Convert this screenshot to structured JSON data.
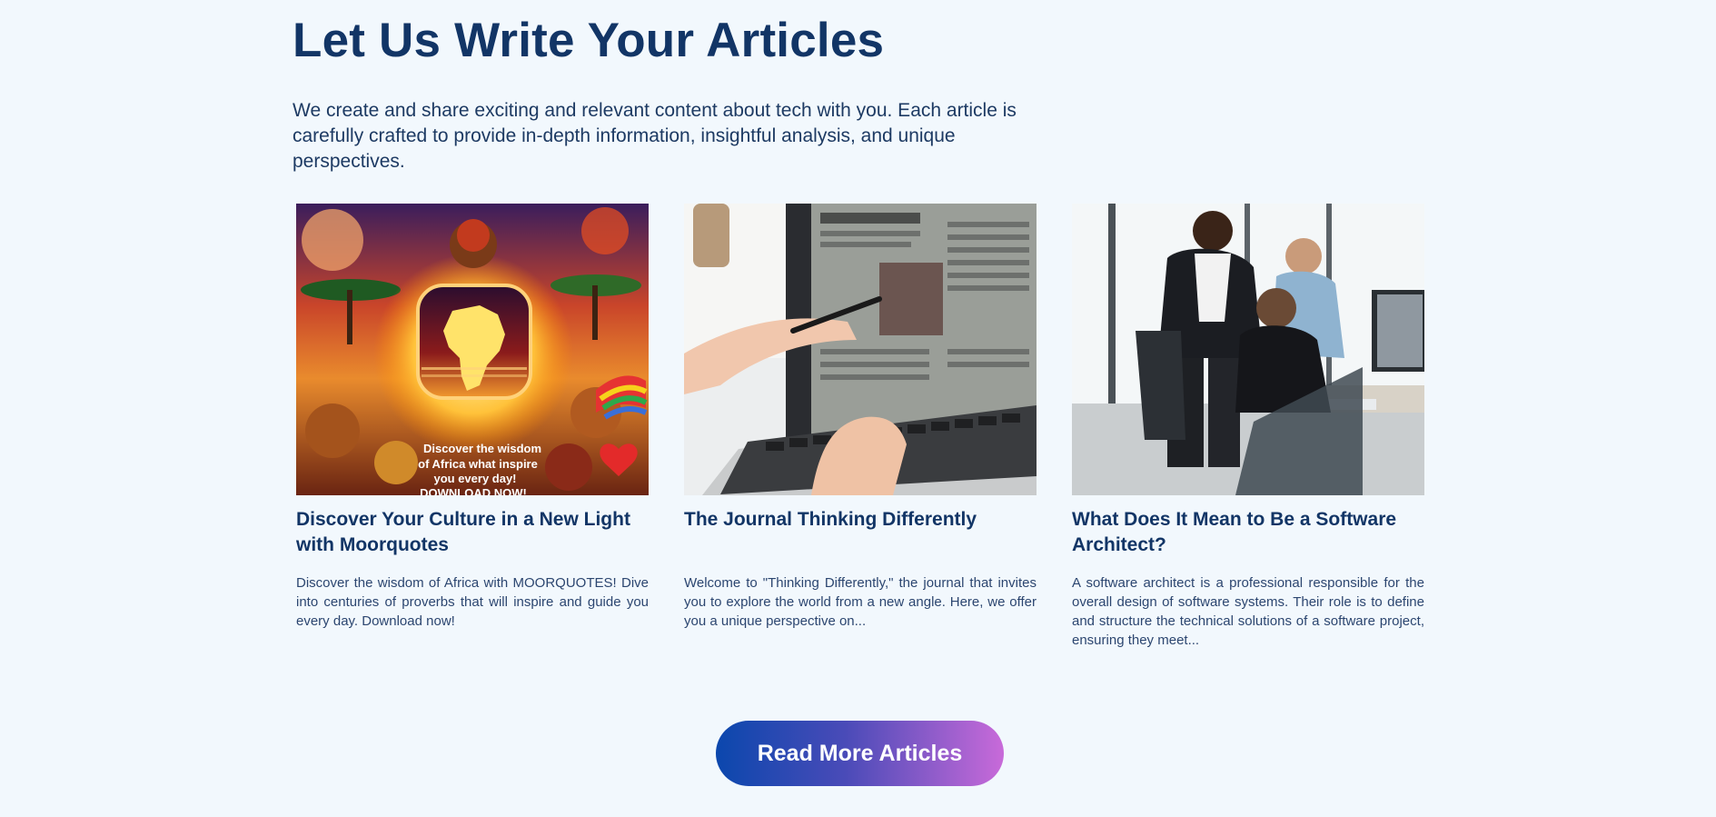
{
  "header": {
    "title": "Let Us Write Your Articles",
    "intro": "We create and share exciting and relevant content about tech with you. Each article is carefully crafted to provide in-depth information, insightful analysis, and unique perspectives."
  },
  "articles": [
    {
      "title": "Discover Your Culture in a New Light with Moorquotes",
      "excerpt": "Discover the wisdom of Africa with MOORQUOTES! Dive into centuries of proverbs that will inspire and guide you every day. Download now!",
      "image_icon": "africa-poster-image",
      "image_text": {
        "line1": "Discover the wisdom",
        "line2": "of Africa what inspire",
        "line3": "you every day!",
        "line4": "DOWNLOAD NOW!"
      }
    },
    {
      "title": "The Journal Thinking Differently",
      "excerpt": "Welcome to \"Thinking Differently,\" the journal that invites you to explore the world from a new angle. Here, we offer you a unique perspective on...",
      "image_icon": "laptop-reading-image"
    },
    {
      "title": "What Does It Mean to Be a Software Architect?",
      "excerpt": "A software architect is a professional responsible for the overall design of software systems. Their role is to define and structure the technical solutions of a software project, ensuring they meet...",
      "image_icon": "office-team-image"
    }
  ],
  "cta": {
    "label": "Read More Articles"
  },
  "colors": {
    "background": "#f2f8fd",
    "heading": "#123566",
    "cta_gradient_start": "#0b47ad",
    "cta_gradient_end": "#c86ad9"
  }
}
